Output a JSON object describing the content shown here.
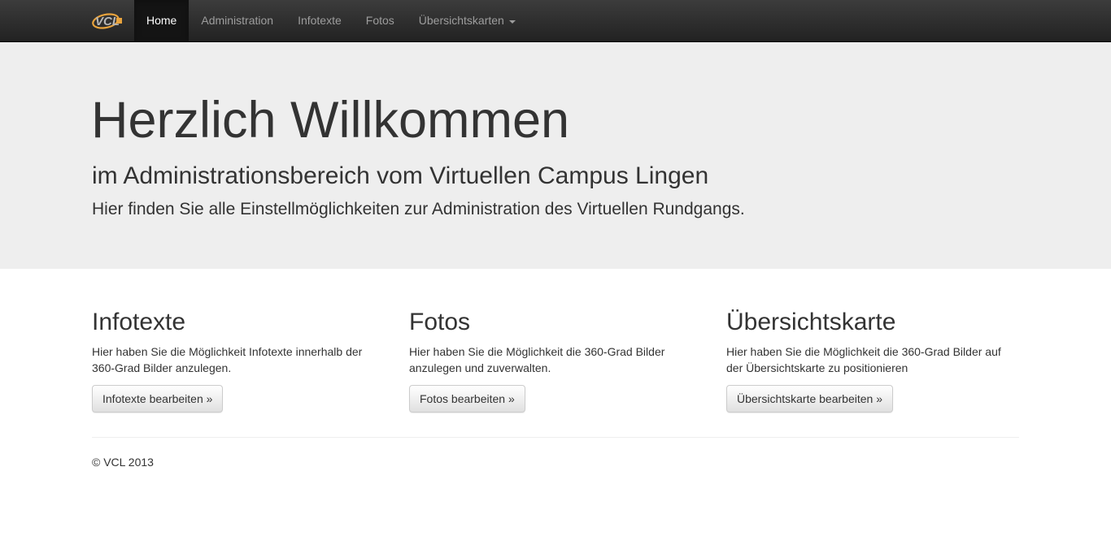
{
  "navbar": {
    "brand": "VCL",
    "items": [
      {
        "label": "Home",
        "active": true
      },
      {
        "label": "Administration",
        "active": false
      },
      {
        "label": "Infotexte",
        "active": false
      },
      {
        "label": "Fotos",
        "active": false
      },
      {
        "label": "Übersichtskarten",
        "active": false,
        "dropdown": true
      }
    ]
  },
  "jumbotron": {
    "title": "Herzlich Willkommen",
    "subtitle": "im Administrationsbereich vom Virtuellen Campus Lingen",
    "lead": "Hier finden Sie alle Einstellmöglichkeiten zur Administration des Virtuellen Rundgangs."
  },
  "columns": [
    {
      "heading": "Infotexte",
      "text_line1": "Hier haben Sie die Möglichkeit Infotexte innerhalb der",
      "text_line2": "360-Grad Bilder anzulegen.",
      "button": "Infotexte bearbeiten »"
    },
    {
      "heading": "Fotos",
      "text_line1": "Hier haben Sie die Möglichkeit die 360-Grad Bilder",
      "text_line2": "anzulegen und zuverwalten.",
      "button": "Fotos bearbeiten »"
    },
    {
      "heading": "Übersichtskarte",
      "text_line1": "Hier haben Sie die Möglichkeit die 360-Grad Bilder auf",
      "text_line2": "der Übersichtskarte zu positionieren",
      "button": "Übersichtskarte bearbeiten »"
    }
  ],
  "footer": {
    "copyright": "© VCL 2013"
  },
  "colors": {
    "navbar_bg": "#222222",
    "nav_text": "#9d9d9d",
    "nav_active_text": "#ffffff",
    "jumbotron_bg": "#eeeeee",
    "logo_orange": "#e8a33d"
  }
}
